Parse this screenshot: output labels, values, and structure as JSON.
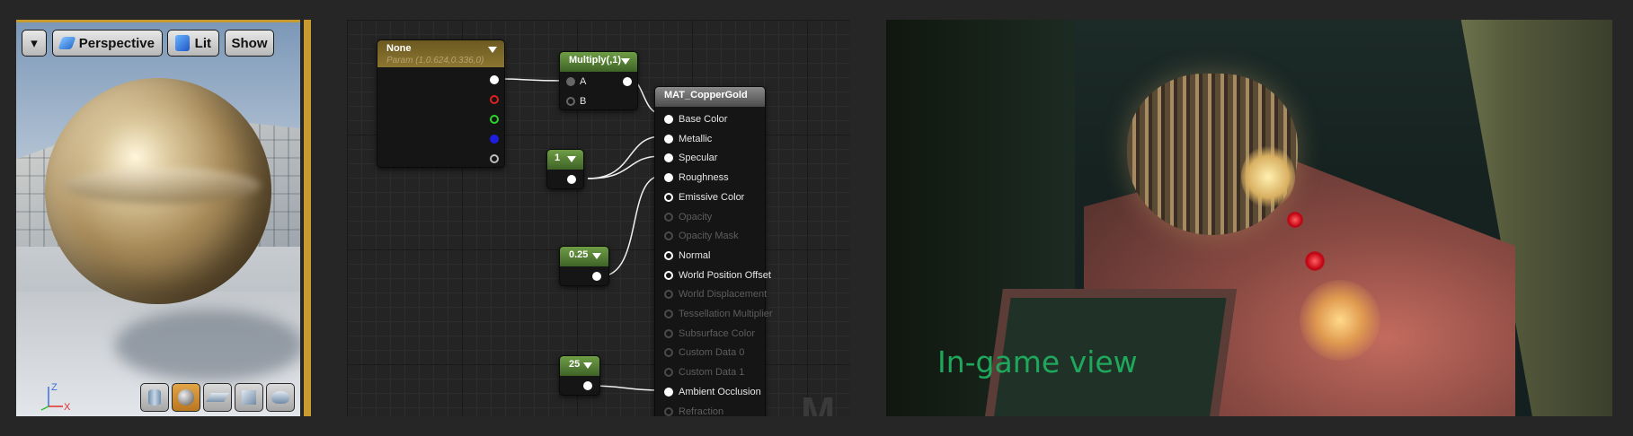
{
  "preview": {
    "toolbar": {
      "dropdown_glyph": "▾",
      "perspective_label": "Perspective",
      "lit_label": "Lit",
      "show_label": "Show"
    },
    "axis": {
      "z": "Z",
      "x": "X"
    },
    "bottom_buttons": [
      {
        "name": "cylinder-preview-button",
        "active": false
      },
      {
        "name": "sphere-preview-button",
        "active": true
      },
      {
        "name": "plane-preview-button",
        "active": false
      },
      {
        "name": "cube-preview-button",
        "active": false
      },
      {
        "name": "custom-mesh-preview-button",
        "active": false
      }
    ]
  },
  "graph": {
    "param_node": {
      "title": "None",
      "subtitle": "Param (1,0.624,0.336,0)"
    },
    "multiply_node": {
      "title": "Multiply(,1)",
      "input_a": "A",
      "input_b": "B"
    },
    "const_1": {
      "value": "1"
    },
    "const_025": {
      "value": "0.25"
    },
    "const_25": {
      "value": "25"
    },
    "material_node": {
      "title": "MAT_CopperGold",
      "pins": [
        {
          "label": "Base Color",
          "enabled": true,
          "connected": true
        },
        {
          "label": "Metallic",
          "enabled": true,
          "connected": true
        },
        {
          "label": "Specular",
          "enabled": true,
          "connected": true
        },
        {
          "label": "Roughness",
          "enabled": true,
          "connected": true
        },
        {
          "label": "Emissive Color",
          "enabled": true,
          "connected": false
        },
        {
          "label": "Opacity",
          "enabled": false,
          "connected": false
        },
        {
          "label": "Opacity Mask",
          "enabled": false,
          "connected": false
        },
        {
          "label": "Normal",
          "enabled": true,
          "connected": false
        },
        {
          "label": "World Position Offset",
          "enabled": true,
          "connected": false
        },
        {
          "label": "World Displacement",
          "enabled": false,
          "connected": false
        },
        {
          "label": "Tessellation Multiplier",
          "enabled": false,
          "connected": false
        },
        {
          "label": "Subsurface Color",
          "enabled": false,
          "connected": false
        },
        {
          "label": "Custom Data 0",
          "enabled": false,
          "connected": false
        },
        {
          "label": "Custom Data 1",
          "enabled": false,
          "connected": false
        },
        {
          "label": "Ambient Occlusion",
          "enabled": true,
          "connected": true
        },
        {
          "label": "Refraction",
          "enabled": false,
          "connected": false
        }
      ]
    },
    "watermark": "M"
  },
  "game_view": {
    "label": "In-game view"
  },
  "colors": {
    "accent": "#c99a2e",
    "game_label": "#1fa85c",
    "red_pin": "#e02020",
    "green_pin": "#2bd42b",
    "blue_pin": "#1e1ee0"
  }
}
